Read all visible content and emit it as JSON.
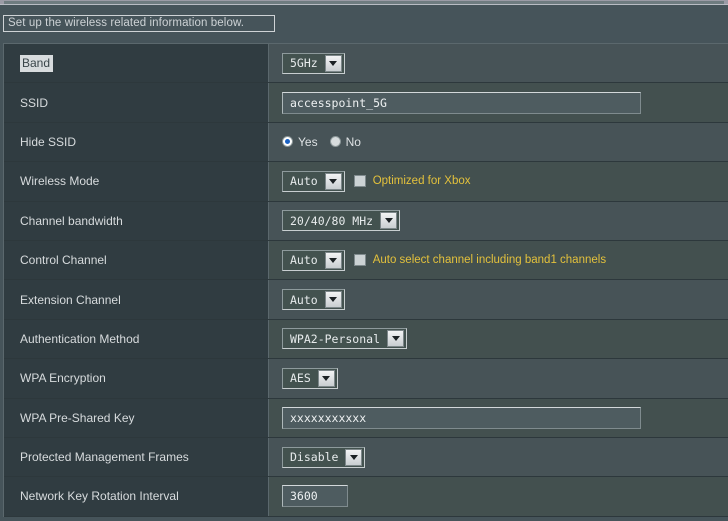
{
  "header": {
    "text": "Set up the wireless related information below."
  },
  "form": {
    "rows": [
      {
        "label": "Band",
        "label_highlighted": true,
        "control": "select",
        "value": "5GHz",
        "name": "band"
      },
      {
        "label": "SSID",
        "control": "text",
        "value": "accesspoint_5G",
        "name": "ssid"
      },
      {
        "label": "Hide SSID",
        "control": "radio",
        "options": [
          "Yes",
          "No"
        ],
        "value": "Yes",
        "name": "hide-ssid"
      },
      {
        "label": "Wireless Mode",
        "control": "select",
        "value": "Auto",
        "checkbox_label": "Optimized for Xbox",
        "checkbox_checked": false,
        "name": "wireless-mode"
      },
      {
        "label": "Channel bandwidth",
        "control": "select",
        "value": "20/40/80 MHz",
        "name": "channel-bandwidth"
      },
      {
        "label": "Control Channel",
        "control": "select",
        "value": "Auto",
        "checkbox_label": "Auto select channel including band1 channels",
        "checkbox_checked": false,
        "name": "control-channel"
      },
      {
        "label": "Extension Channel",
        "control": "select",
        "value": "Auto",
        "name": "extension-channel"
      },
      {
        "label": "Authentication Method",
        "control": "select",
        "value": "WPA2-Personal",
        "name": "authentication-method"
      },
      {
        "label": "WPA Encryption",
        "control": "select",
        "value": "AES",
        "name": "wpa-encryption"
      },
      {
        "label": "WPA Pre-Shared Key",
        "control": "text",
        "value": "xxxxxxxxxxx",
        "name": "wpa-pre-shared-key"
      },
      {
        "label": "Protected Management Frames",
        "control": "select",
        "value": "Disable",
        "name": "protected-management-frames"
      },
      {
        "label": "Network Key Rotation Interval",
        "control": "text-narrow",
        "value": "3600",
        "name": "network-key-rotation-interval"
      }
    ]
  },
  "colors": {
    "page_background": "#46545a",
    "label_column": "#303c41",
    "value_column": "#475357",
    "note_text": "#e3c13c",
    "radio_selected": "#1b62c4",
    "text": "#d7dbdd"
  }
}
